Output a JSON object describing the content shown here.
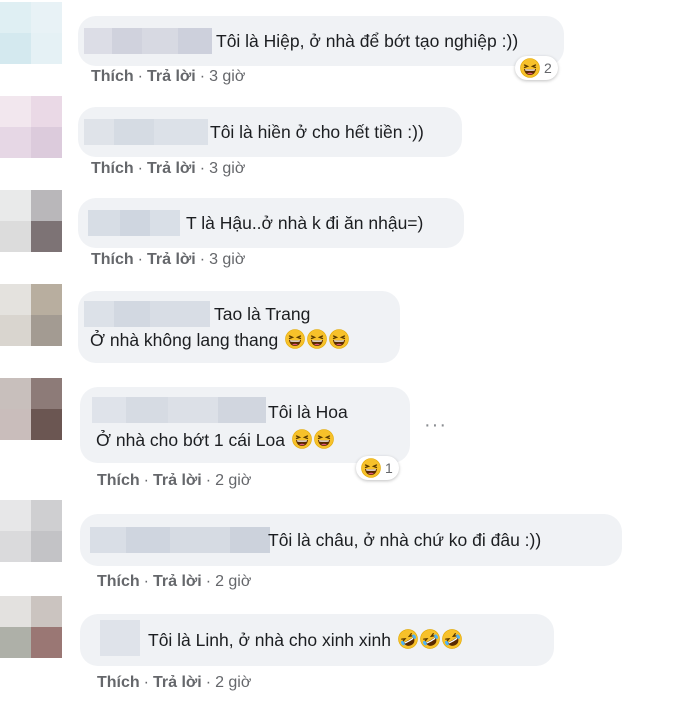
{
  "comments": [
    {
      "line1": "Tôi là Hiệp, ở nhà để bớt tạo nghiệp :))",
      "like": "Thích",
      "reply": "Trả lời",
      "time": "3 giờ",
      "reaction_count": "2"
    },
    {
      "line1": "Tôi là hiền ở cho hết tiền :))",
      "like": "Thích",
      "reply": "Trả lời",
      "time": "3 giờ"
    },
    {
      "line1": "T là Hậu..ở nhà k đi ăn nhậu=)",
      "like": "Thích",
      "reply": "Trả lời",
      "time": "3 giờ"
    },
    {
      "line1": "Tao là Trang",
      "line2": "Ở nhà không lang thang"
    },
    {
      "line1": "Tôi là Hoa",
      "line2": "Ở nhà cho bớt 1 cái Loa",
      "like": "Thích",
      "reply": "Trả lời",
      "time": "2 giờ",
      "reaction_count": "1",
      "more": "···"
    },
    {
      "line1": "Tôi là châu, ở nhà chứ ko đi đâu :))",
      "like": "Thích",
      "reply": "Trả lời",
      "time": "2 giờ"
    },
    {
      "line1": "Tôi là Linh, ở nhà cho xinh xinh",
      "like": "Thích",
      "reply": "Trả lời",
      "time": "2 giờ"
    }
  ],
  "colors": {
    "bubble": "#f0f2f5",
    "meta_text": "#65676b",
    "emoji_yellow": "#f7c12a"
  },
  "icons": {
    "laugh": "grinning-squinting-emoji-icon",
    "rofl": "rolling-on-floor-laughing-emoji-icon"
  }
}
